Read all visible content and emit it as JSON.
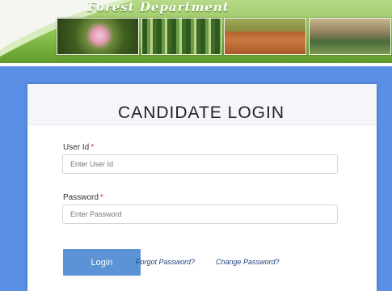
{
  "header": {
    "title": "Forest Department",
    "photos": [
      "flower-photo",
      "forest-photo",
      "nursery-field-photo",
      "plant-beds-photo"
    ]
  },
  "login": {
    "title": "CANDIDATE LOGIN",
    "user_label": "User Id",
    "user_placeholder": "Enter User Id",
    "password_label": "Password",
    "password_placeholder": "Enter Password",
    "required_marker": "*",
    "login_button": "Login",
    "forgot_link": "Forgot Password?",
    "change_link": "Change Password?"
  },
  "colors": {
    "backdrop": "#5a8fe6",
    "button": "#5c93d6",
    "required": "#e02b2b",
    "banner_green": "#8cc24f"
  }
}
